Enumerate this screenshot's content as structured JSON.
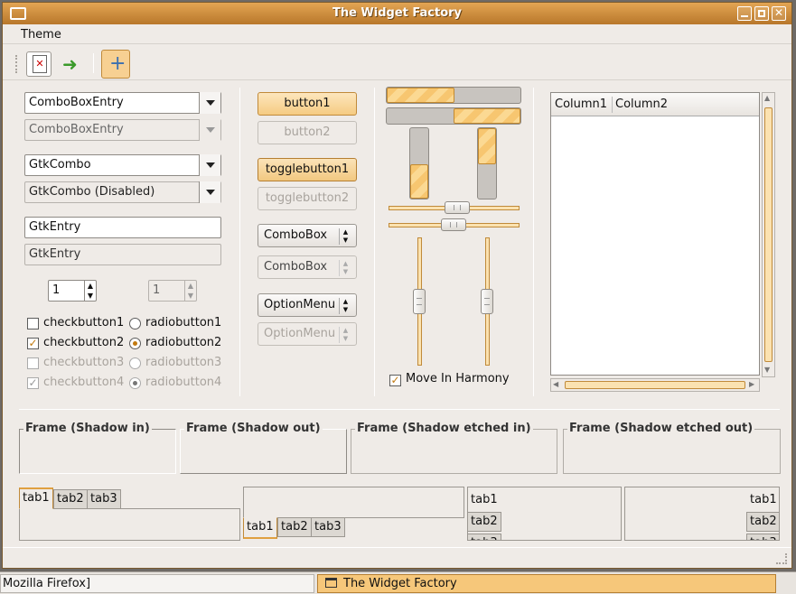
{
  "window": {
    "title": "The Widget Factory"
  },
  "menu": {
    "theme": "Theme"
  },
  "toolbar": {
    "icons": [
      "close-document-icon",
      "jump-to-icon",
      "add-icon"
    ]
  },
  "combo": {
    "entry1": "ComboBoxEntry",
    "entry2": "ComboBoxEntry",
    "gtk1": "GtkCombo",
    "gtk2": "GtkCombo (Disabled)"
  },
  "entries": {
    "e1": "GtkEntry",
    "e2": "GtkEntry"
  },
  "spin": {
    "s1": "1",
    "s2": "1"
  },
  "checks": [
    "checkbutton1",
    "checkbutton2",
    "checkbutton3",
    "checkbutton4"
  ],
  "radios": [
    "radiobutton1",
    "radiobutton2",
    "radiobutton3",
    "radiobutton4"
  ],
  "buttons": {
    "b1": "button1",
    "b2": "button2",
    "t1": "togglebutton1",
    "t2": "togglebutton2",
    "cb1": "ComboBox",
    "cb2": "ComboBox",
    "om1": "OptionMenu",
    "om2": "OptionMenu"
  },
  "progress": {
    "h1": 0.5,
    "h2": 0.5,
    "v1": 0.5,
    "v2": 0.5
  },
  "harmony": {
    "label": "Move In Harmony",
    "checked": true
  },
  "tree": {
    "col1": "Column1",
    "col2": "Column2"
  },
  "frames": [
    "Frame (Shadow in)",
    "Frame (Shadow out)",
    "Frame (Shadow etched in)",
    "Frame (Shadow etched out)"
  ],
  "tabs": [
    "tab1",
    "tab2",
    "tab3"
  ],
  "taskbar": {
    "left": "Mozilla Firefox]",
    "right": "The Widget Factory"
  },
  "colors": {
    "accent": "#f5cb82",
    "titlebar": "#c98a3b"
  }
}
